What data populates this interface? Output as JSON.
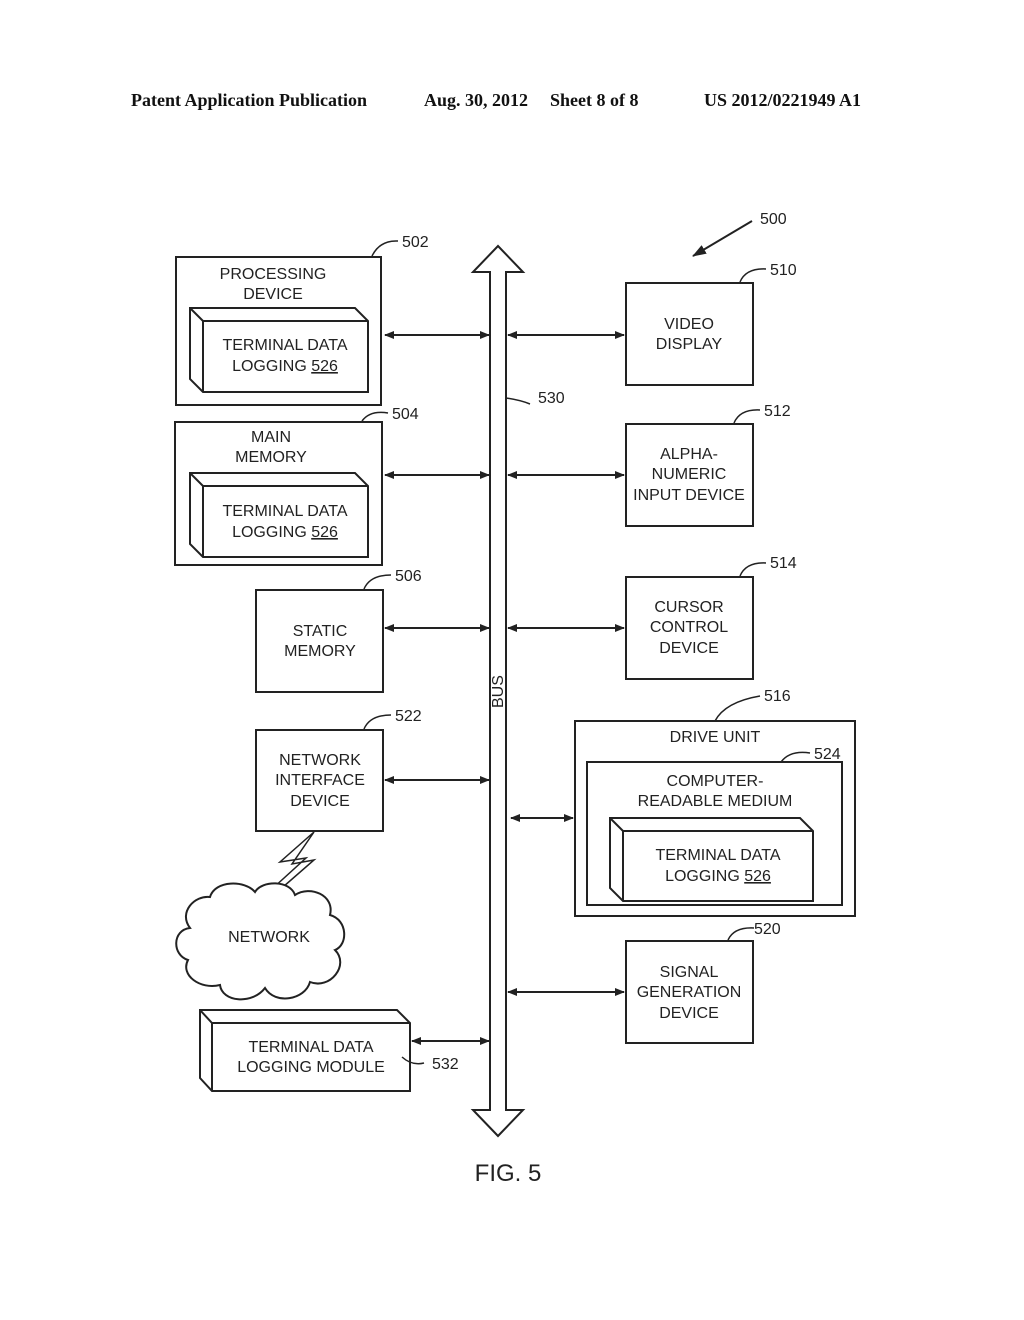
{
  "header": {
    "publication": "Patent Application Publication",
    "date": "Aug. 30, 2012",
    "sheet": "Sheet 8 of 8",
    "patent_number": "US 2012/0221949 A1"
  },
  "diagram": {
    "system_ref": "500",
    "bus": {
      "label": "BUS",
      "ref": "530"
    },
    "processing_device": {
      "line1": "PROCESSING",
      "line2": "DEVICE",
      "ref": "502"
    },
    "main_memory": {
      "line1": "MAIN",
      "line2": "MEMORY",
      "ref": "504"
    },
    "static_memory": {
      "line1": "STATIC",
      "line2": "MEMORY",
      "ref": "506"
    },
    "network_interface": {
      "line1": "NETWORK",
      "line2": "INTERFACE",
      "line3": "DEVICE",
      "ref": "522"
    },
    "network": {
      "label": "NETWORK"
    },
    "logging_module": {
      "line1": "TERMINAL DATA",
      "line2": "LOGGING MODULE",
      "ref": "532"
    },
    "video_display": {
      "line1": "VIDEO",
      "line2": "DISPLAY",
      "ref": "510"
    },
    "alphanumeric": {
      "line1": "ALPHA-",
      "line2": "NUMERIC",
      "line3": "INPUT DEVICE",
      "ref": "512"
    },
    "cursor_control": {
      "line1": "CURSOR",
      "line2": "CONTROL",
      "line3": "DEVICE",
      "ref": "514"
    },
    "drive_unit": {
      "label": "DRIVE UNIT",
      "ref": "516"
    },
    "computer_readable_medium": {
      "line1": "COMPUTER-",
      "line2": "READABLE MEDIUM",
      "ref": "524"
    },
    "signal_generation": {
      "line1": "SIGNAL",
      "line2": "GENERATION",
      "line3": "DEVICE",
      "ref": "520"
    },
    "terminal_logging": {
      "line1": "TERMINAL DATA",
      "line2_prefix": "LOGGING ",
      "ref": "526"
    }
  },
  "figure_label": "FIG. 5"
}
